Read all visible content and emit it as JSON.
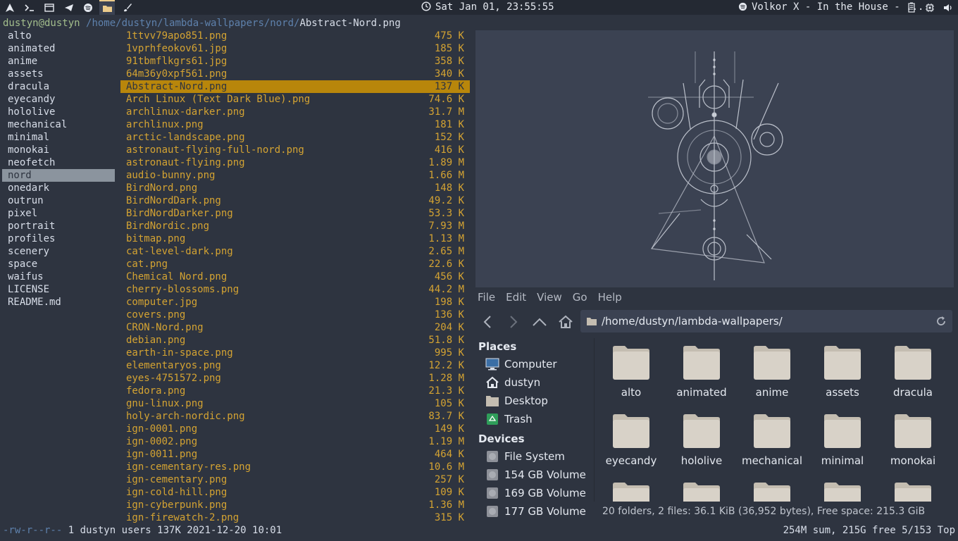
{
  "topbar": {
    "icons": [
      "arch-icon",
      "terminal-icon",
      "window-icon",
      "telegram-icon",
      "spotify-icon",
      "folder-icon",
      "brush-icon"
    ],
    "clock": "Sat Jan 01, 23:55:55",
    "music": "Volkor X - In the House - ..."
  },
  "ranger": {
    "user": "dustyn@dustyn",
    "path_dir": "/home/dustyn/lambda-wallpapers/nord/",
    "path_file": "Abstract-Nord.png",
    "left_items": [
      "alto",
      "animated",
      "anime",
      "assets",
      "dracula",
      "eyecandy",
      "hololive",
      "mechanical",
      "minimal",
      "monokai",
      "neofetch",
      "nord",
      "onedark",
      "outrun",
      "pixel",
      "portrait",
      "profiles",
      "scenery",
      "space",
      "waifus",
      "LICENSE",
      "README.md"
    ],
    "left_selected": 11,
    "files": [
      {
        "name": "1ttvv79apo851.png",
        "size": "475 K"
      },
      {
        "name": "1vprhfeokov61.jpg",
        "size": "185 K"
      },
      {
        "name": "91tbmflkgrs61.jpg",
        "size": "358 K"
      },
      {
        "name": "64m36y0xpf561.png",
        "size": "340 K"
      },
      {
        "name": "Abstract-Nord.png",
        "size": "137 K"
      },
      {
        "name": "Arch Linux (Text Dark Blue).png",
        "size": "74.6 K"
      },
      {
        "name": "archlinux-darker.png",
        "size": "31.7 M"
      },
      {
        "name": "archlinux.png",
        "size": "181 K"
      },
      {
        "name": "arctic-landscape.png",
        "size": "152 K"
      },
      {
        "name": "astronaut-flying-full-nord.png",
        "size": "416 K"
      },
      {
        "name": "astronaut-flying.png",
        "size": "1.89 M"
      },
      {
        "name": "audio-bunny.png",
        "size": "1.66 M"
      },
      {
        "name": "BirdNord.png",
        "size": "148 K"
      },
      {
        "name": "BirdNordDark.png",
        "size": "49.2 K"
      },
      {
        "name": "BirdNordDarker.png",
        "size": "53.3 K"
      },
      {
        "name": "BirdNordic.png",
        "size": "7.93 M"
      },
      {
        "name": "bitmap.png",
        "size": "1.13 M"
      },
      {
        "name": "cat-level-dark.png",
        "size": "2.65 M"
      },
      {
        "name": "cat.png",
        "size": "22.6 K"
      },
      {
        "name": "Chemical Nord.png",
        "size": "456 K"
      },
      {
        "name": "cherry-blossoms.png",
        "size": "44.2 M"
      },
      {
        "name": "computer.jpg",
        "size": "198 K"
      },
      {
        "name": "covers.png",
        "size": "136 K"
      },
      {
        "name": "CRON-Nord.png",
        "size": "204 K"
      },
      {
        "name": "debian.png",
        "size": "51.8 K"
      },
      {
        "name": "earth-in-space.png",
        "size": "995 K"
      },
      {
        "name": "elementaryos.png",
        "size": "12.2 K"
      },
      {
        "name": "eyes-4751572.png",
        "size": "1.28 M"
      },
      {
        "name": "fedora.png",
        "size": "21.3 K"
      },
      {
        "name": "gnu-linux.png",
        "size": "105 K"
      },
      {
        "name": "holy-arch-nordic.png",
        "size": "83.7 K"
      },
      {
        "name": "ign-0001.png",
        "size": "149 K"
      },
      {
        "name": "ign-0002.png",
        "size": "1.19 M"
      },
      {
        "name": "ign-0011.png",
        "size": "464 K"
      },
      {
        "name": "ign-cementary-res.png",
        "size": "10.6 M"
      },
      {
        "name": "ign-cementary.png",
        "size": "257 K"
      },
      {
        "name": "ign-cold-hill.png",
        "size": "109 K"
      },
      {
        "name": "ign-cyberpunk.png",
        "size": "1.36 M"
      },
      {
        "name": "ign-firewatch-2.png",
        "size": "315 K"
      }
    ],
    "selected_file": 4,
    "status_perm": "-rw-r--r--",
    "status_info": " 1 dustyn users 137K 2021-12-20 10:01",
    "status_right": "254M sum, 215G free  5/153  Top"
  },
  "fm": {
    "menu": [
      "File",
      "Edit",
      "View",
      "Go",
      "Help"
    ],
    "address": "/home/dustyn/lambda-wallpapers/",
    "places_title": "Places",
    "places": [
      {
        "label": "Computer",
        "icon": "computer-icon"
      },
      {
        "label": "dustyn",
        "icon": "home-icon"
      },
      {
        "label": "Desktop",
        "icon": "desktop-icon"
      },
      {
        "label": "Trash",
        "icon": "trash-icon"
      }
    ],
    "devices_title": "Devices",
    "devices": [
      {
        "label": "File System",
        "icon": "drive-icon"
      },
      {
        "label": "154 GB Volume",
        "icon": "drive-icon"
      },
      {
        "label": "169 GB Volume",
        "icon": "drive-icon"
      },
      {
        "label": "177 GB Volume",
        "icon": "drive-icon"
      }
    ],
    "folders": [
      "alto",
      "animated",
      "anime",
      "assets",
      "dracula",
      "eyecandy",
      "hololive",
      "mechanical",
      "minimal",
      "monokai",
      "",
      "",
      "",
      "",
      ""
    ],
    "status": "20 folders, 2 files: 36.1 KiB (36,952 bytes), Free space: 215.3 GiB",
    "colors": {
      "folder": "#d8d2c8",
      "folder_tab": "#c4bdb1",
      "accent": "#b8860b",
      "file": "#d4a332"
    }
  }
}
